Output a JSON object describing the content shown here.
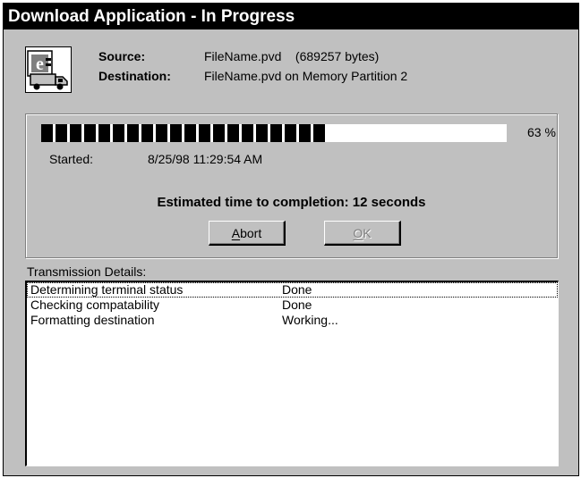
{
  "window": {
    "title": "Download Application - In Progress"
  },
  "info": {
    "icon": "download-truck-icon",
    "source_label": "Source:",
    "source_value": "FileName.pvd    (689257 bytes)",
    "destination_label": "Destination:",
    "destination_value": "FileName.pvd on Memory Partition 2"
  },
  "progress": {
    "value": 0.63,
    "percent_text": "63 %",
    "started_label": "Started:",
    "started_value": "8/25/98 11:29:54 AM",
    "eta_text": "Estimated time to completion: 12 seconds",
    "abort_prefix": "",
    "abort_mnemonic": "A",
    "abort_rest": "bort",
    "ok_prefix": "",
    "ok_mnemonic": "O",
    "ok_rest": "K"
  },
  "details": {
    "label": "Transmission Details:",
    "rows": [
      {
        "task": "Determining terminal status",
        "status": "Done"
      },
      {
        "task": "Checking compatability",
        "status": "Done"
      },
      {
        "task": "Formatting destination",
        "status": "Working..."
      }
    ]
  }
}
